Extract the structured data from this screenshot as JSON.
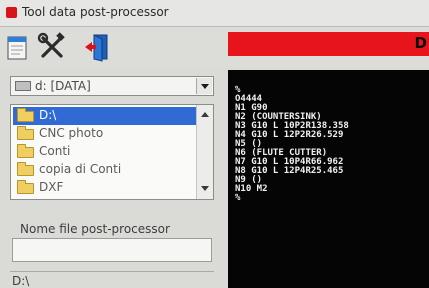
{
  "window": {
    "title": "Tool data post-processor"
  },
  "toolbar": {
    "buttons": [
      {
        "icon": "new-file-icon"
      },
      {
        "icon": "tools-icon"
      },
      {
        "icon": "exit-door-icon"
      }
    ],
    "alarm_text": "D",
    "alarm_color": "#e8141c"
  },
  "drive_select": {
    "value": "d: [DATA]"
  },
  "folder_list": {
    "items": [
      {
        "label": "D:\\",
        "selected": true
      },
      {
        "label": "CNC photo",
        "selected": false
      },
      {
        "label": "Conti",
        "selected": false
      },
      {
        "label": "copia di Conti",
        "selected": false
      },
      {
        "label": "DXF",
        "selected": false
      }
    ]
  },
  "output_name": {
    "label": "Nome file post-processor",
    "value": ""
  },
  "current_path": "D:\\",
  "nc_code": {
    "lines": [
      "%",
      "O4444",
      "N1 G90",
      "N2 (COUNTERSINK)",
      "N3 G10 L 10P2R138.358",
      "N4 G10 L 12P2R26.529",
      "N5 ()",
      "N6 (FLUTE CUTTER)",
      "N7 G10 L 10P4R66.962",
      "N8 G10 L 12P4R25.465",
      "N9 ()",
      "N10 M2",
      "%"
    ]
  },
  "colors": {
    "selection": "#2f6ad5",
    "console_background": "#050505",
    "console_text": "#f2f2f2"
  }
}
